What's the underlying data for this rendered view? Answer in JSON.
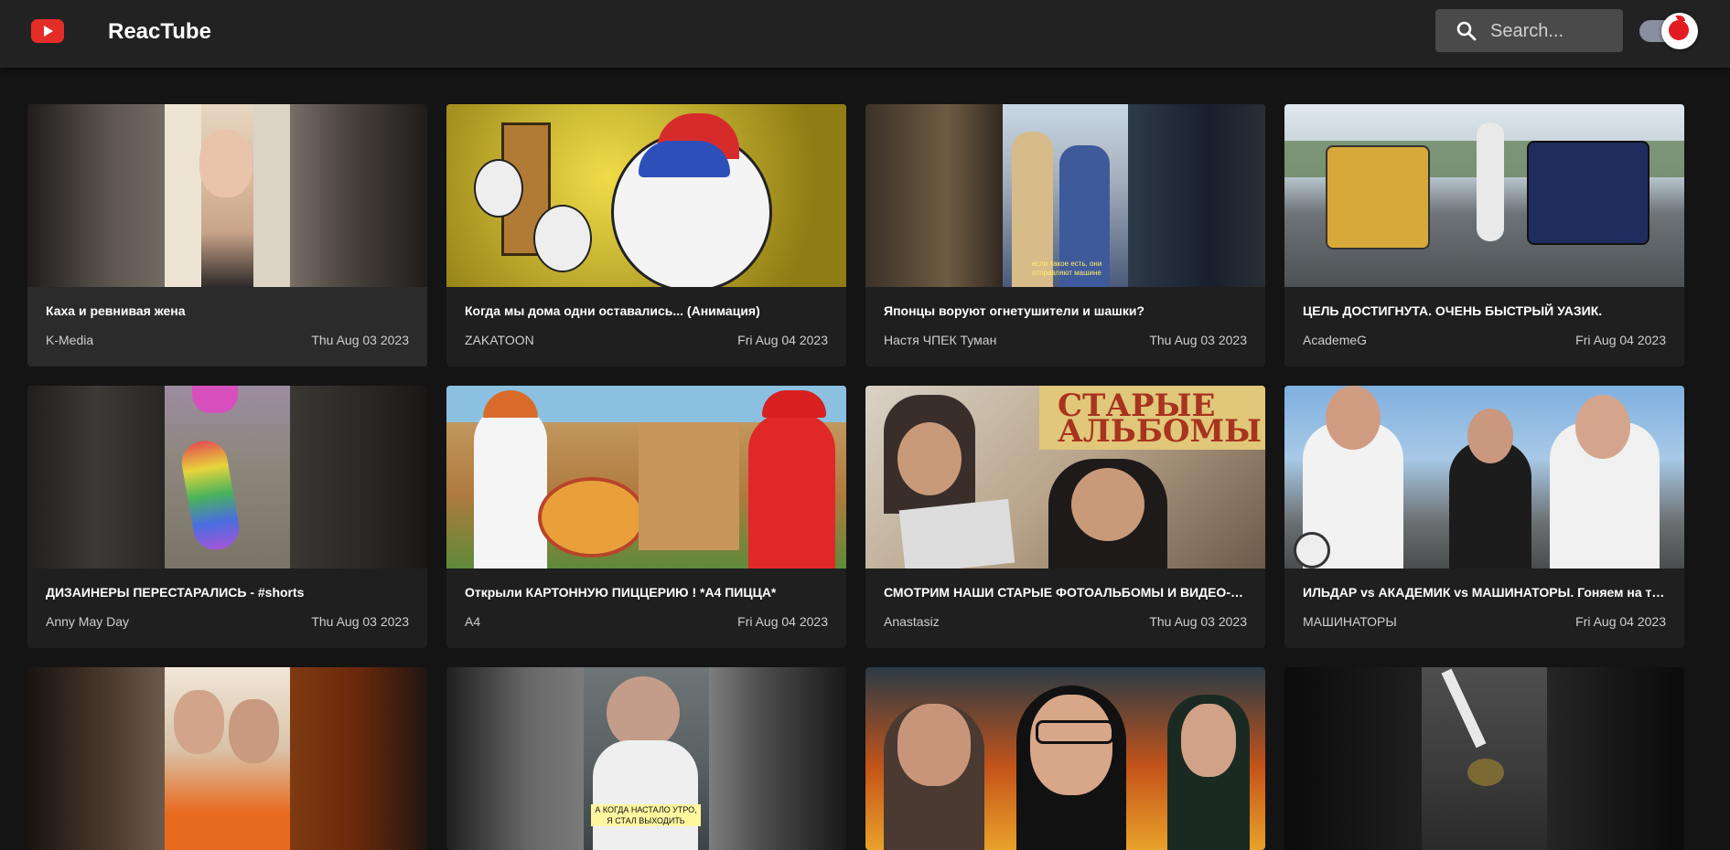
{
  "header": {
    "brand": "ReacTube",
    "search_placeholder": "Search..."
  },
  "videos": [
    {
      "title": "Каха и ревнивая жена",
      "channel": "K-Media",
      "date": "Thu Aug 03 2023"
    },
    {
      "title": "Когда мы дома одни оставались... (Анимация)",
      "channel": "ZAKATOON",
      "date": "Fri Aug 04 2023"
    },
    {
      "title": "Японцы воруют огнетушители и шашки?",
      "channel": "Настя ЧПЕК Туман",
      "date": "Thu Aug 03 2023"
    },
    {
      "title": "ЦЕЛЬ ДОСТИГНУТА. ОЧЕНЬ БЫСТРЫЙ УАЗИК.",
      "channel": "AcademeG",
      "date": "Fri Aug 04 2023"
    },
    {
      "title": "ДИЗАИНЕРЫ ПЕРЕСТАРАЛИСЬ - #shorts",
      "channel": "Anny May Day",
      "date": "Thu Aug 03 2023"
    },
    {
      "title": "Открыли КАРТОННУЮ ПИЦЦЕРИЮ ! *А4 ПИЦЦА*",
      "channel": "A4",
      "date": "Fri Aug 04 2023"
    },
    {
      "title": "СМОТРИМ НАШИ СТАРЫЕ ФОТОАЛЬБОМЫ И ВИДЕО-КАСТ...",
      "channel": "Anastasiz",
      "date": "Thu Aug 03 2023"
    },
    {
      "title": "ИЛЬДАР vs АКАДЕМИК vs МАШИНАТОРЫ. Гоняем на тре...",
      "channel": "МАШИНАТОРЫ",
      "date": "Fri Aug 04 2023"
    }
  ],
  "thumb_captions": {
    "japan": "если такое есть, они отправляют машине",
    "cook": "А КОГДА НАСТАЛО УТРО, Я СТАЛ ВЫХОДИТЬ"
  },
  "colors": {
    "accent": "#e52d27",
    "background": "#141414",
    "header": "#222222",
    "card": "#1f1f1f"
  }
}
